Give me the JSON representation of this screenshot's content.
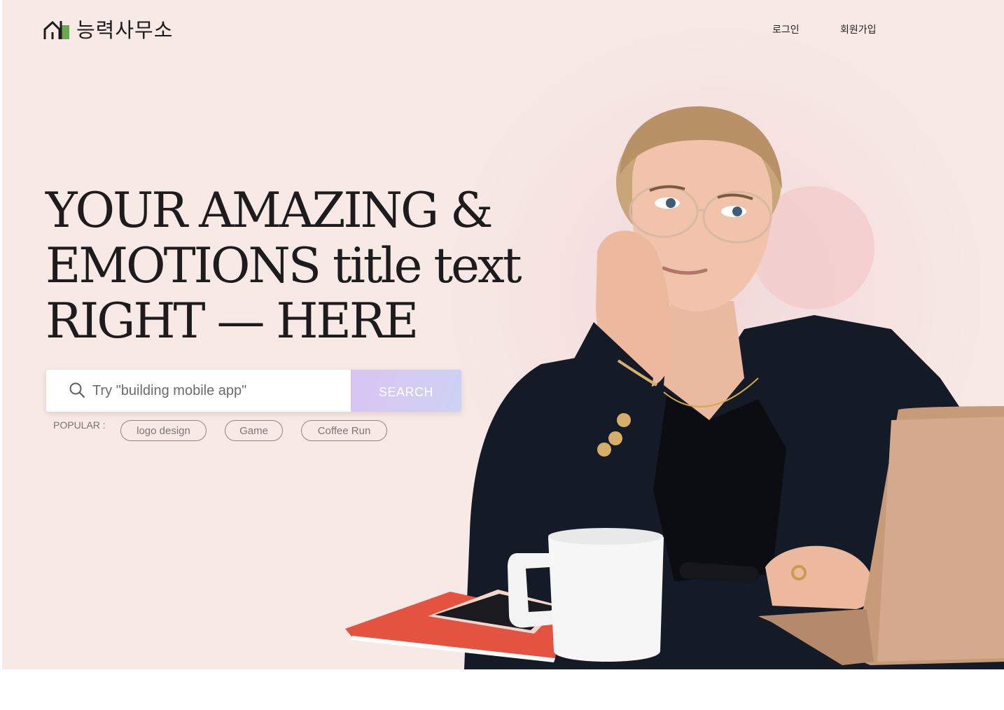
{
  "brand": {
    "name": "능력사무소",
    "icon": "house-logo-icon"
  },
  "nav": {
    "login": "로그인",
    "signup": "회원가입"
  },
  "hero": {
    "title_lines": [
      "YOUR AMAZING &",
      "EMOTIONS title text",
      "RIGHT — HERE"
    ]
  },
  "search": {
    "placeholder": "Try \"building mobile app\"",
    "button_label": "SEARCH",
    "icon": "search-icon"
  },
  "popular": {
    "label": "POPULAR :",
    "tags": [
      "logo design",
      "Game",
      "Coffee Run"
    ]
  },
  "colors": {
    "hero_bg": "#f7e9e6",
    "accent_circle": "#f3cdcc",
    "button_gradient_start": "#d9c4f2",
    "button_gradient_end": "#cdd2f3",
    "logo_green": "#6aa84f"
  }
}
